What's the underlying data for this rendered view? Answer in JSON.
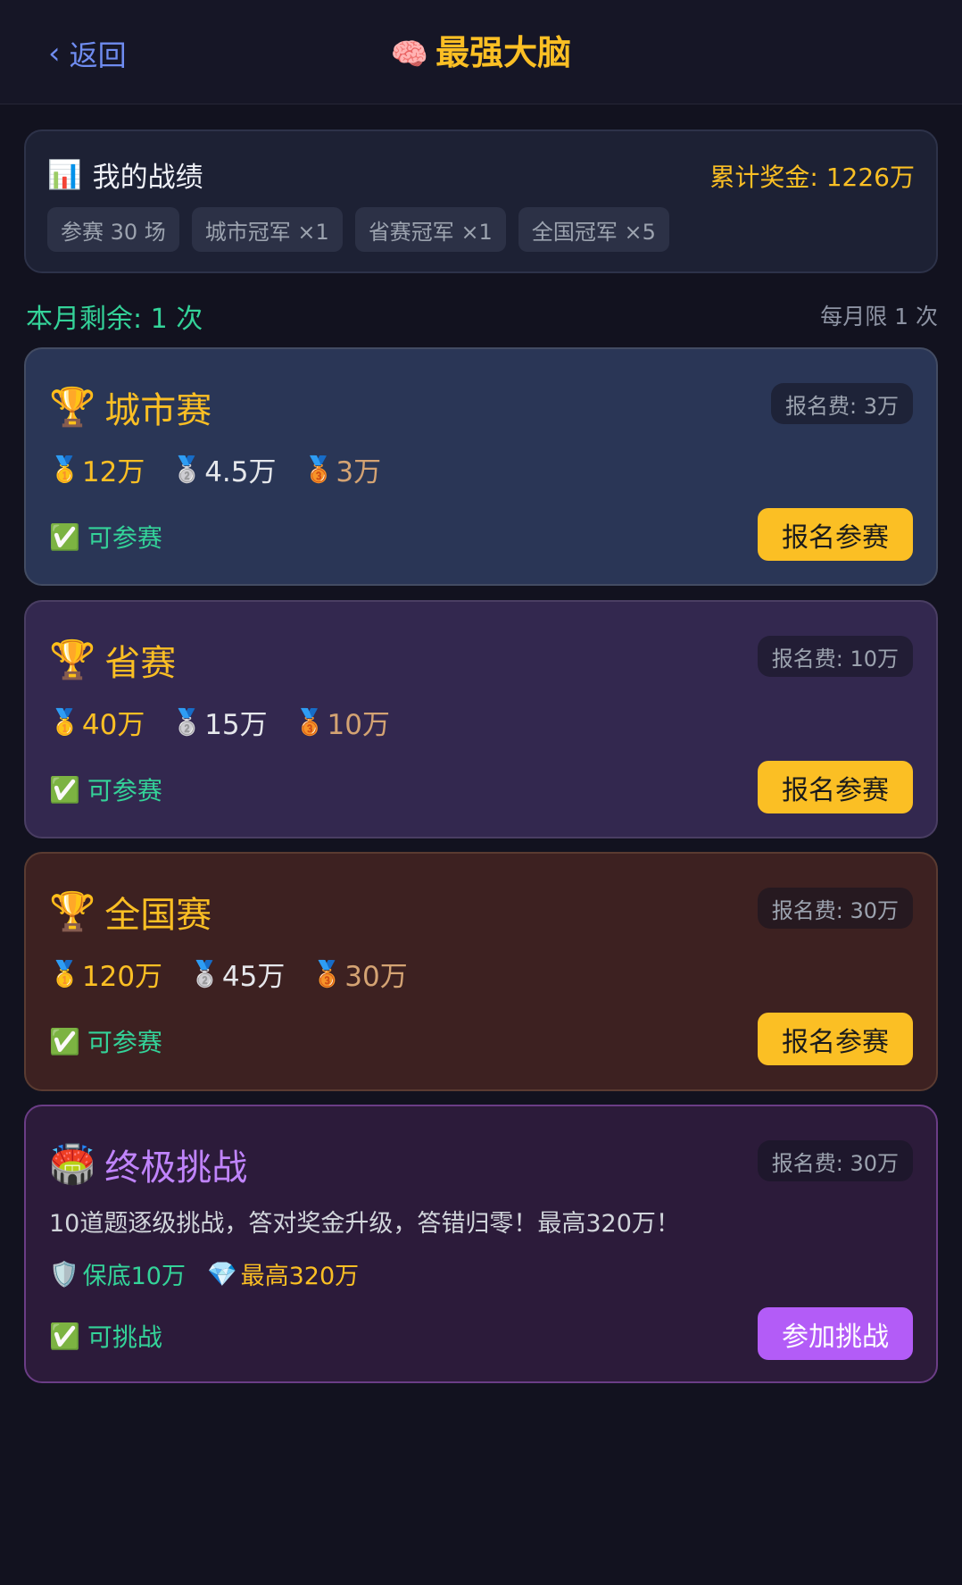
{
  "header": {
    "back_label": "返回",
    "back_icon": "chevron-left",
    "title_icon": "🧠",
    "title": "最强大脑"
  },
  "stats": {
    "icon": "📊",
    "title": "我的战绩",
    "total": "累计奖金: 1226万",
    "chips": [
      "参赛 30 场",
      "城市冠军 ×1",
      "省赛冠军 ×1",
      "全国冠军 ×5"
    ]
  },
  "quota": {
    "remaining": "本月剩余: 1 次",
    "limit": "每月限 1 次"
  },
  "competitions": [
    {
      "icon": "🏆",
      "name": "城市赛",
      "fee": "报名费: 3万",
      "prizes": [
        {
          "medal": "🥇",
          "amount": "12万"
        },
        {
          "medal": "🥈",
          "amount": "4.5万"
        },
        {
          "medal": "🥉",
          "amount": "3万"
        }
      ],
      "status_icon": "✅",
      "status": "可参赛",
      "button": "报名参赛"
    },
    {
      "icon": "🏆",
      "name": "省赛",
      "fee": "报名费: 10万",
      "prizes": [
        {
          "medal": "🥇",
          "amount": "40万"
        },
        {
          "medal": "🥈",
          "amount": "15万"
        },
        {
          "medal": "🥉",
          "amount": "10万"
        }
      ],
      "status_icon": "✅",
      "status": "可参赛",
      "button": "报名参赛"
    },
    {
      "icon": "🏆",
      "name": "全国赛",
      "fee": "报名费: 30万",
      "prizes": [
        {
          "medal": "🥇",
          "amount": "120万"
        },
        {
          "medal": "🥈",
          "amount": "45万"
        },
        {
          "medal": "🥉",
          "amount": "30万"
        }
      ],
      "status_icon": "✅",
      "status": "可参赛",
      "button": "报名参赛"
    }
  ],
  "ultimate": {
    "icon": "🏟️",
    "name": "终极挑战",
    "fee": "报名费: 30万",
    "description": "10道题逐级挑战，答对奖金升级，答错归零！最高320万！",
    "floor_icon": "🛡️",
    "floor": "保底10万",
    "max_icon": "💎",
    "max": "最高320万",
    "status_icon": "✅",
    "status": "可挑战",
    "button": "参加挑战"
  },
  "colors": {
    "background": "#12121f",
    "accent_gold": "#fbbf24",
    "accent_green": "#34d399",
    "accent_purple": "#b35cf7",
    "link_blue": "#6f8cf0"
  }
}
